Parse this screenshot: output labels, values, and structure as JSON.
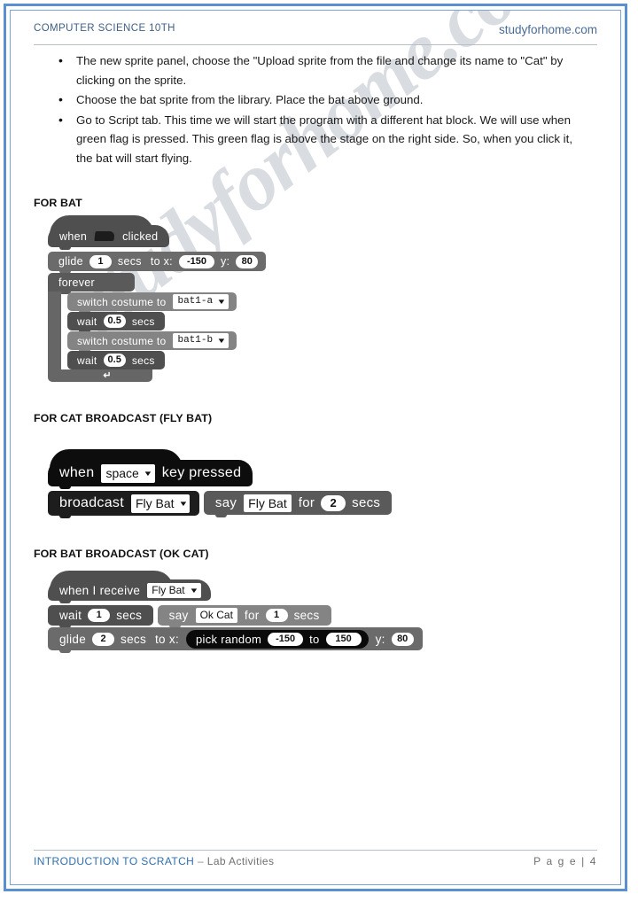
{
  "header": {
    "left_title": "COMPUTER SCIENCE 10TH",
    "right_site": "studyforhome.com"
  },
  "watermark": {
    "text": "studyforhome.com"
  },
  "body": {
    "bullets": [
      "The new sprite panel, choose the \"Upload sprite from the file and change its name to \"Cat\" by clicking on the sprite.",
      "Choose the bat sprite from the library. Place the bat above ground.",
      "Go to Script tab. This time we will start the program with a different hat block. We will use when green flag is pressed. This green flag is above the stage on the right side. So, when you click it, the bat will start flying."
    ]
  },
  "sections": [
    {
      "heading": "FOR BAT",
      "script": {
        "hat": {
          "word_when": "when",
          "icon": "green-flag-icon",
          "word_clicked": "clicked"
        },
        "glide": {
          "word_glide": "glide",
          "secs_value": "1",
          "word_secs": "secs",
          "word_to_x": "to x:",
          "x_value": "-150",
          "word_y": "y:",
          "y_value": "80"
        },
        "forever_label": "forever",
        "loop_body": [
          {
            "type": "switch",
            "label": "switch costume to",
            "dropdown": "bat1-a"
          },
          {
            "type": "wait",
            "label_a": "wait",
            "value": "0.5",
            "label_b": "secs"
          },
          {
            "type": "switch",
            "label": "switch costume to",
            "dropdown": "bat1-b"
          },
          {
            "type": "wait",
            "label_a": "wait",
            "value": "0.5",
            "label_b": "secs"
          }
        ],
        "loop_arrow": "↵"
      }
    },
    {
      "heading": "FOR CAT BROADCAST (FLY BAT)",
      "script": {
        "hat": {
          "word_when": "when",
          "dropdown": "space",
          "tail": "key pressed"
        },
        "broadcast": {
          "label": "broadcast",
          "dropdown": "Fly Bat"
        },
        "say": {
          "label_say": "say",
          "message": "Fly Bat",
          "label_for": "for",
          "value": "2",
          "label_secs": "secs"
        }
      }
    },
    {
      "heading": "FOR BAT BROADCAST (OK CAT)",
      "script": {
        "hat": {
          "label": "when I receive",
          "dropdown": "Fly Bat"
        },
        "wait": {
          "label_a": "wait",
          "value": "1",
          "label_b": "secs"
        },
        "say": {
          "label_say": "say",
          "message": "Ok Cat",
          "label_for": "for",
          "value": "1",
          "label_secs": "secs"
        },
        "glide": {
          "word_glide": "glide",
          "secs_value": "2",
          "word_secs": "secs",
          "word_to_x": "to x:",
          "pick_random_label": "pick random",
          "rand_from": "-150",
          "word_to": "to",
          "rand_to": "150",
          "word_y": "y:",
          "y_value": "80"
        }
      }
    }
  ],
  "footer": {
    "title": "INTRODUCTION TO SCRATCH",
    "dash": "–",
    "subtitle": "Lab Activities",
    "page": "P a g e  | 4"
  },
  "colors": {
    "frame_blue": "#5b8fd0",
    "header_blue": "#3f5f86",
    "footer_blue": "#2f6fb0",
    "watermark_gray": "#d9dde1"
  }
}
